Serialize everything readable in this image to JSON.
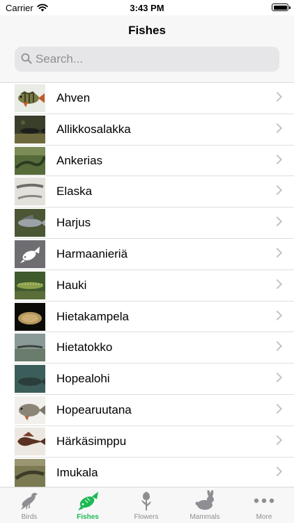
{
  "status_bar": {
    "carrier": "Carrier",
    "time": "3:43 PM"
  },
  "nav": {
    "title": "Fishes"
  },
  "search": {
    "placeholder": "Search..."
  },
  "list": {
    "items": [
      {
        "label": "Ahven"
      },
      {
        "label": "Allikkosalakka"
      },
      {
        "label": "Ankerias"
      },
      {
        "label": "Elaska"
      },
      {
        "label": "Harjus"
      },
      {
        "label": "Harmaanieriä"
      },
      {
        "label": "Hauki"
      },
      {
        "label": "Hietakampela"
      },
      {
        "label": "Hietatokko"
      },
      {
        "label": "Hopealohi"
      },
      {
        "label": "Hopearuutana"
      },
      {
        "label": "Härkäsimppu"
      },
      {
        "label": "Imukala"
      }
    ]
  },
  "tabbar": {
    "tabs": [
      {
        "label": "Birds",
        "icon": "bird-icon"
      },
      {
        "label": "Fishes",
        "icon": "fish-icon",
        "active": true
      },
      {
        "label": "Flowers",
        "icon": "flower-icon"
      },
      {
        "label": "Mammals",
        "icon": "rabbit-icon"
      },
      {
        "label": "More",
        "icon": "more-icon"
      }
    ]
  },
  "colors": {
    "accent": "#1db954",
    "inactive": "#8e8e93"
  }
}
